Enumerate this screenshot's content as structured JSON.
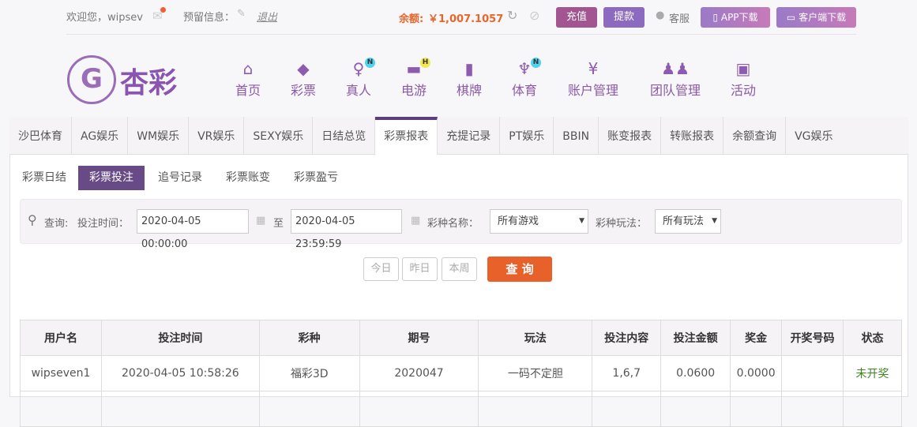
{
  "topbar": {
    "welcome": "欢迎您，wipsev",
    "reserved_info": "预留信息：",
    "logout": "退出",
    "balance_label": "余额:",
    "balance_value": "￥1,007.1057",
    "deposit": "充值",
    "withdraw": "提款",
    "support": "客服",
    "app_download": "APP下载",
    "client_download": "客户端下载"
  },
  "logo": {
    "text": "杏彩"
  },
  "nav": [
    {
      "label": "首页",
      "icon": "home-icon"
    },
    {
      "label": "彩票",
      "icon": "ticket-icon"
    },
    {
      "label": "真人",
      "icon": "woman-icon",
      "badge": "N"
    },
    {
      "label": "电游",
      "icon": "gamepad-icon",
      "badge": "H"
    },
    {
      "label": "棋牌",
      "icon": "cards-icon"
    },
    {
      "label": "体育",
      "icon": "trophy-icon",
      "badge": "N"
    },
    {
      "label": "账户管理",
      "icon": "yen-coin-icon"
    },
    {
      "label": "团队管理",
      "icon": "users-icon"
    },
    {
      "label": "活动",
      "icon": "gift-icon"
    }
  ],
  "tabs": [
    "沙巴体育",
    "AG娱乐",
    "WM娱乐",
    "VR娱乐",
    "SEXY娱乐",
    "日结总览",
    "彩票报表",
    "充提记录",
    "PT娱乐",
    "BBIN",
    "账变报表",
    "转账报表",
    "余额查询",
    "VG娱乐"
  ],
  "subtabs": [
    "彩票日结",
    "彩票投注",
    "追号记录",
    "彩票账变",
    "彩票盈亏"
  ],
  "filter": {
    "query_label": "查询:",
    "time_label": "投注时间：",
    "start": "2020-04-05 00:00:00",
    "to": "至",
    "end": "2020-04-05 23:59:59",
    "game_label": "彩种名称：",
    "game_value": "所有游戏",
    "play_label": "彩种玩法：",
    "play_value": "所有玩法"
  },
  "quick": {
    "today": "今日",
    "yesterday": "昨日",
    "week": "本周",
    "search": "查 询"
  },
  "table": {
    "headers": [
      "用户名",
      "投注时间",
      "彩种",
      "期号",
      "玩法",
      "投注内容",
      "投注金额",
      "奖金",
      "开奖号码",
      "状态"
    ],
    "rows": [
      [
        "wipseven1",
        "2020-04-05 10:58:26",
        "福彩3D",
        "2020047",
        "一码不定胆",
        "1,6,7",
        "0.0600",
        "0.0000",
        "",
        "未开奖"
      ]
    ]
  }
}
